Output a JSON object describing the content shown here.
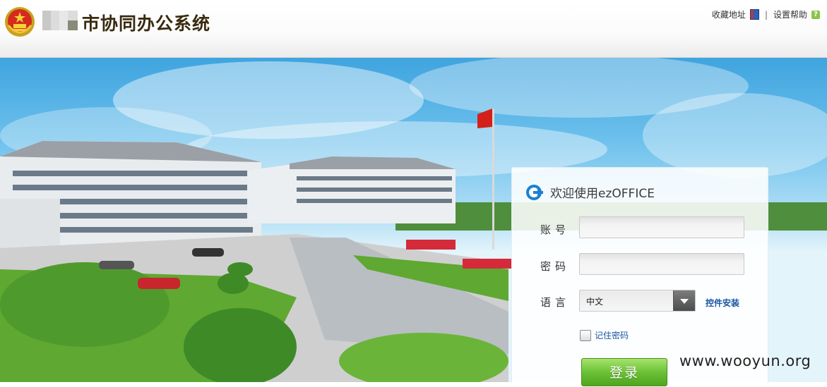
{
  "header": {
    "title": "市协同办公系统",
    "links": {
      "favorite": "收藏地址",
      "separator": "|",
      "help": "设置帮助"
    }
  },
  "login": {
    "welcome": "欢迎使用ezOFFICE",
    "account_label": "账号",
    "password_label": "密码",
    "account_value": "",
    "password_value": "",
    "language_label": "语言",
    "language_selected": "中文",
    "install_link": "控件安装",
    "remember_label": "记住密码",
    "remember_checked": false,
    "submit_label": "登录"
  },
  "watermark": "www.wooyun.org",
  "colors": {
    "title": "#3a2a0e",
    "link_blue": "#1a55a3",
    "login_green": "#6cc236",
    "sky": "#6cc0ec"
  },
  "icons": {
    "emblem": "national-emblem-icon",
    "favorite": "book-icon",
    "help": "help-icon",
    "welcome": "arrow-circle-icon",
    "dropdown": "chevron-down-icon"
  }
}
